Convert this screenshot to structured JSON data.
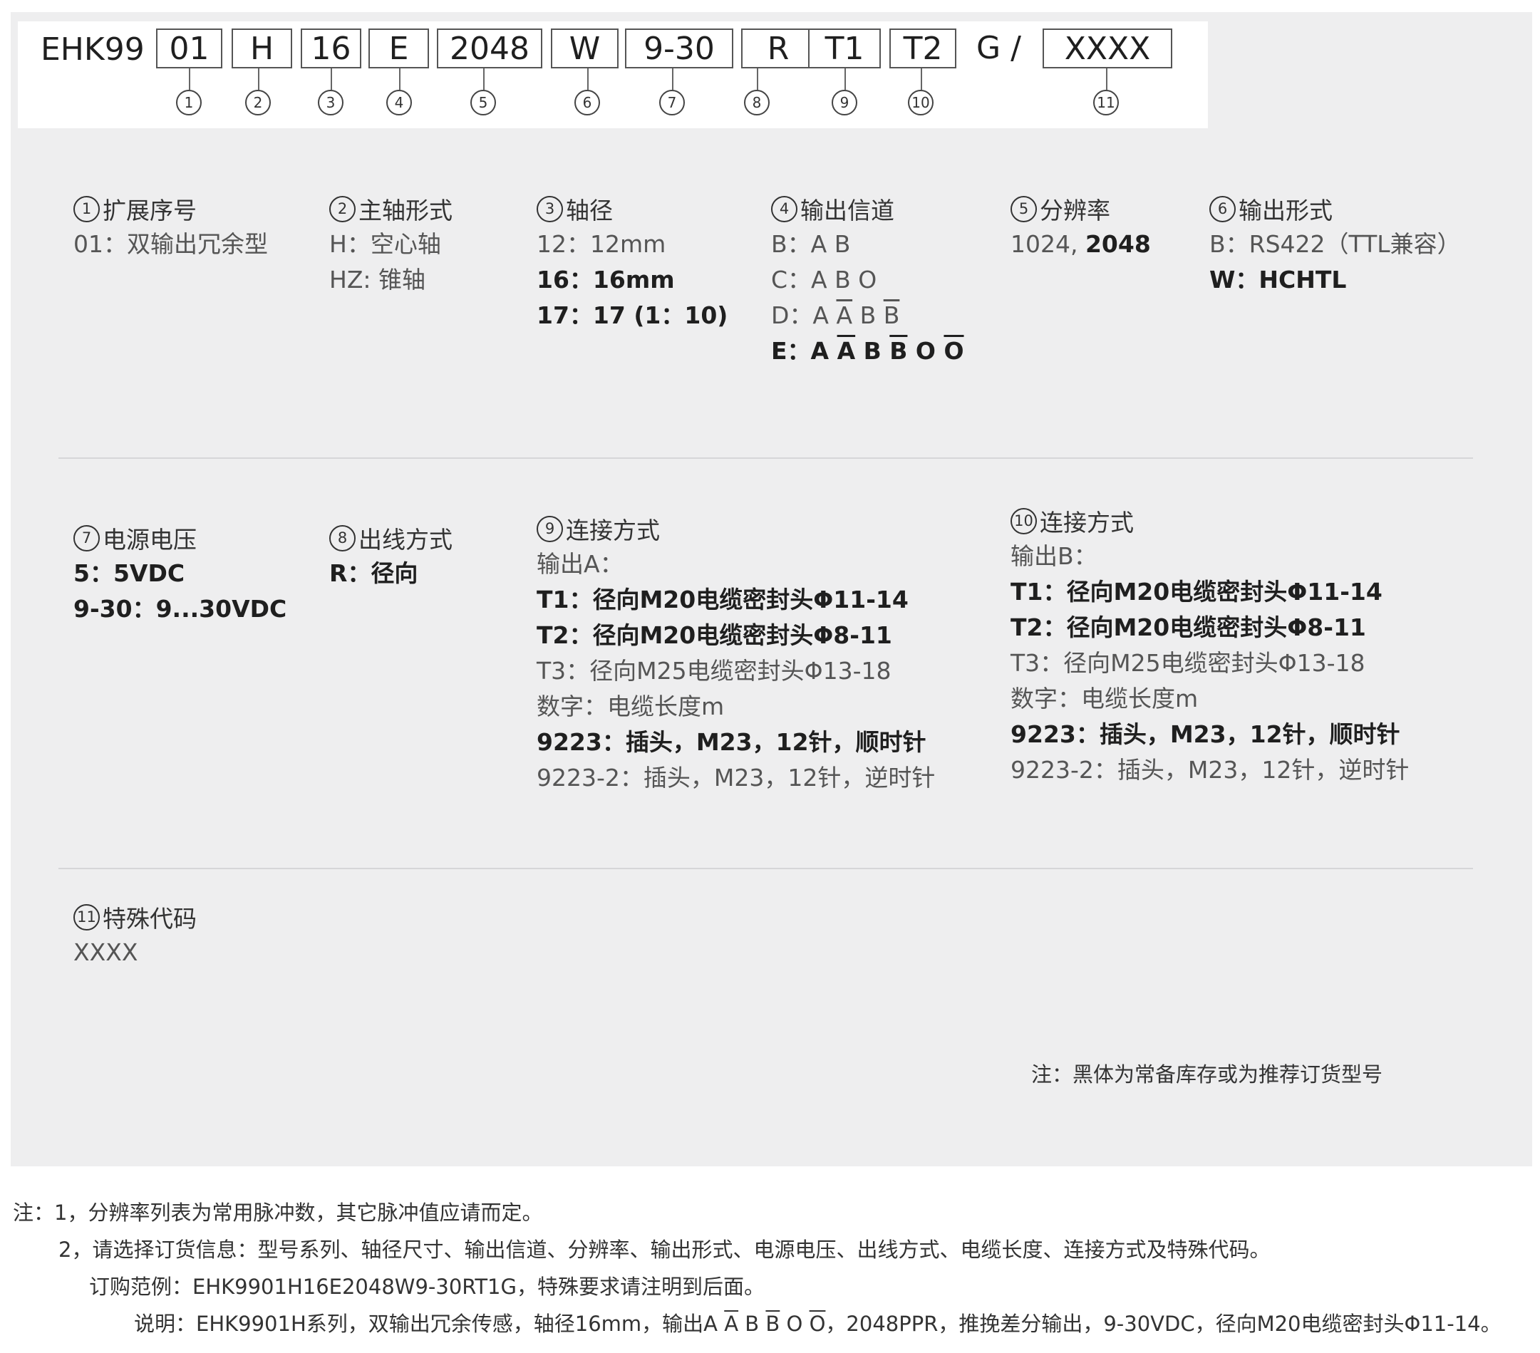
{
  "code": {
    "prefix": "EHK99",
    "segments": [
      "01",
      "H",
      "16",
      "E",
      "2048",
      "W",
      "9-30",
      "R",
      "T1",
      "T2"
    ],
    "g_text": "G /",
    "last": "XXXX",
    "markers": [
      "1",
      "2",
      "3",
      "4",
      "5",
      "6",
      "7",
      "8",
      "9",
      "10",
      "11"
    ]
  },
  "sections": {
    "s1": {
      "num": "1",
      "title": "扩展序号",
      "lines": [
        "01：双输出冗余型"
      ]
    },
    "s2": {
      "num": "2",
      "title": "主轴形式",
      "lines": [
        "H：空心轴",
        "HZ: 锥轴"
      ]
    },
    "s3": {
      "num": "3",
      "title": "轴径",
      "lines": [
        "12：12mm",
        "16：16mm",
        "17：17 (1：10)"
      ]
    },
    "s4": {
      "num": "4",
      "title": "输出信道",
      "b_label": "B：A B",
      "c_label": "C：A B O",
      "d_label": "D：",
      "e_label": "E："
    },
    "s5": {
      "num": "5",
      "title": "分辨率",
      "regular": "1024, ",
      "bold": "2048"
    },
    "s6": {
      "num": "6",
      "title": "输出形式",
      "lines": [
        "B：RS422（TTL兼容）",
        "W：HCHTL"
      ]
    },
    "s7": {
      "num": "7",
      "title": "电源电压",
      "lines": [
        "5：5VDC",
        "9-30：9...30VDC"
      ]
    },
    "s8": {
      "num": "8",
      "title": "出线方式",
      "lines": [
        "R：径向"
      ]
    },
    "s9": {
      "num": "9",
      "title": "连接方式",
      "lines": [
        "输出A：",
        "T1：径向M20电缆密封头Φ11-14",
        "T2：径向M20电缆密封头Φ8-11",
        "T3：径向M25电缆密封头Φ13-18",
        "数字：电缆长度m",
        "9223：插头，M23，12针，顺时针",
        "9223-2：插头，M23，12针，逆时针"
      ]
    },
    "s10": {
      "num": "10",
      "title": "连接方式",
      "lines": [
        "输出B：",
        "T1：径向M20电缆密封头Φ11-14",
        "T2：径向M20电缆密封头Φ8-11",
        "T3：径向M25电缆密封头Φ13-18",
        "数字：电缆长度m",
        "9223：插头，M23，12针，顺时针",
        "9223-2：插头，M23，12针，逆时针"
      ]
    },
    "s11": {
      "num": "11",
      "title": "特殊代码",
      "lines": [
        "XXXX"
      ]
    }
  },
  "panel_note": "注：黑体为常备库存或为推荐订货型号",
  "footer": {
    "line1": "注：1，分辨率列表为常用脉冲数，其它脉冲值应请而定。",
    "line2": "2，请选择订货信息：型号系列、轴径尺寸、输出信道、分辨率、输出形式、电源电压、出线方式、电缆长度、连接方式及特殊代码。",
    "line3": "订购范例：EHK9901H16E2048W9-30RT1G，特殊要求请注明到后面。",
    "line4_a": "说明：EHK9901H系列，双输出冗余传感，轴径16mm，输出",
    "line4_b": "，2048PPR，推挽差分输出，9-30VDC，径向M20电缆密封头Φ11-14。"
  }
}
